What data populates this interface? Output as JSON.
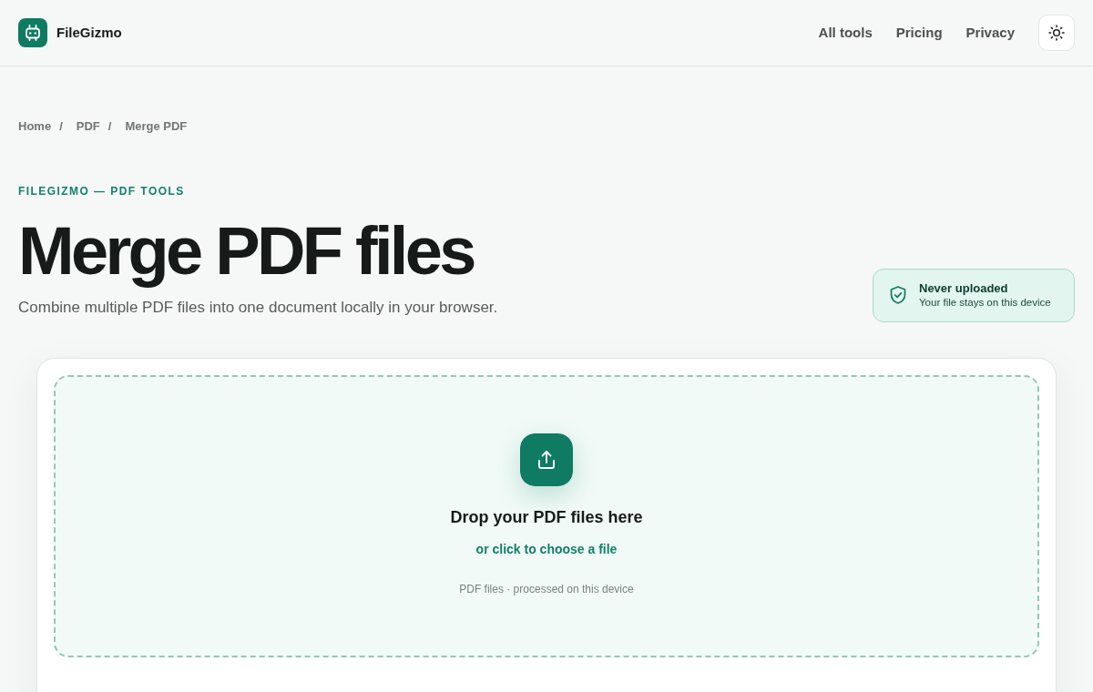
{
  "header": {
    "brand": "FileGizmo",
    "nav": [
      {
        "label": "All tools"
      },
      {
        "label": "Pricing"
      },
      {
        "label": "Privacy"
      }
    ]
  },
  "breadcrumb": [
    {
      "label": "Home",
      "separator": "/"
    },
    {
      "label": "PDF",
      "separator": "/"
    },
    {
      "label": "Merge PDF"
    }
  ],
  "hero": {
    "eyebrow": "FILEGIZMO — PDF TOOLS",
    "title": "Merge PDF files",
    "subtitle": "Combine multiple PDF files into one document locally in your browser."
  },
  "privacy_badge": {
    "title": "Never uploaded",
    "text": "Your file stays on this device"
  },
  "dropzone": {
    "title": "Drop your PDF files here",
    "link": "or click to choose a file",
    "note": "PDF files · processed on this device"
  }
}
